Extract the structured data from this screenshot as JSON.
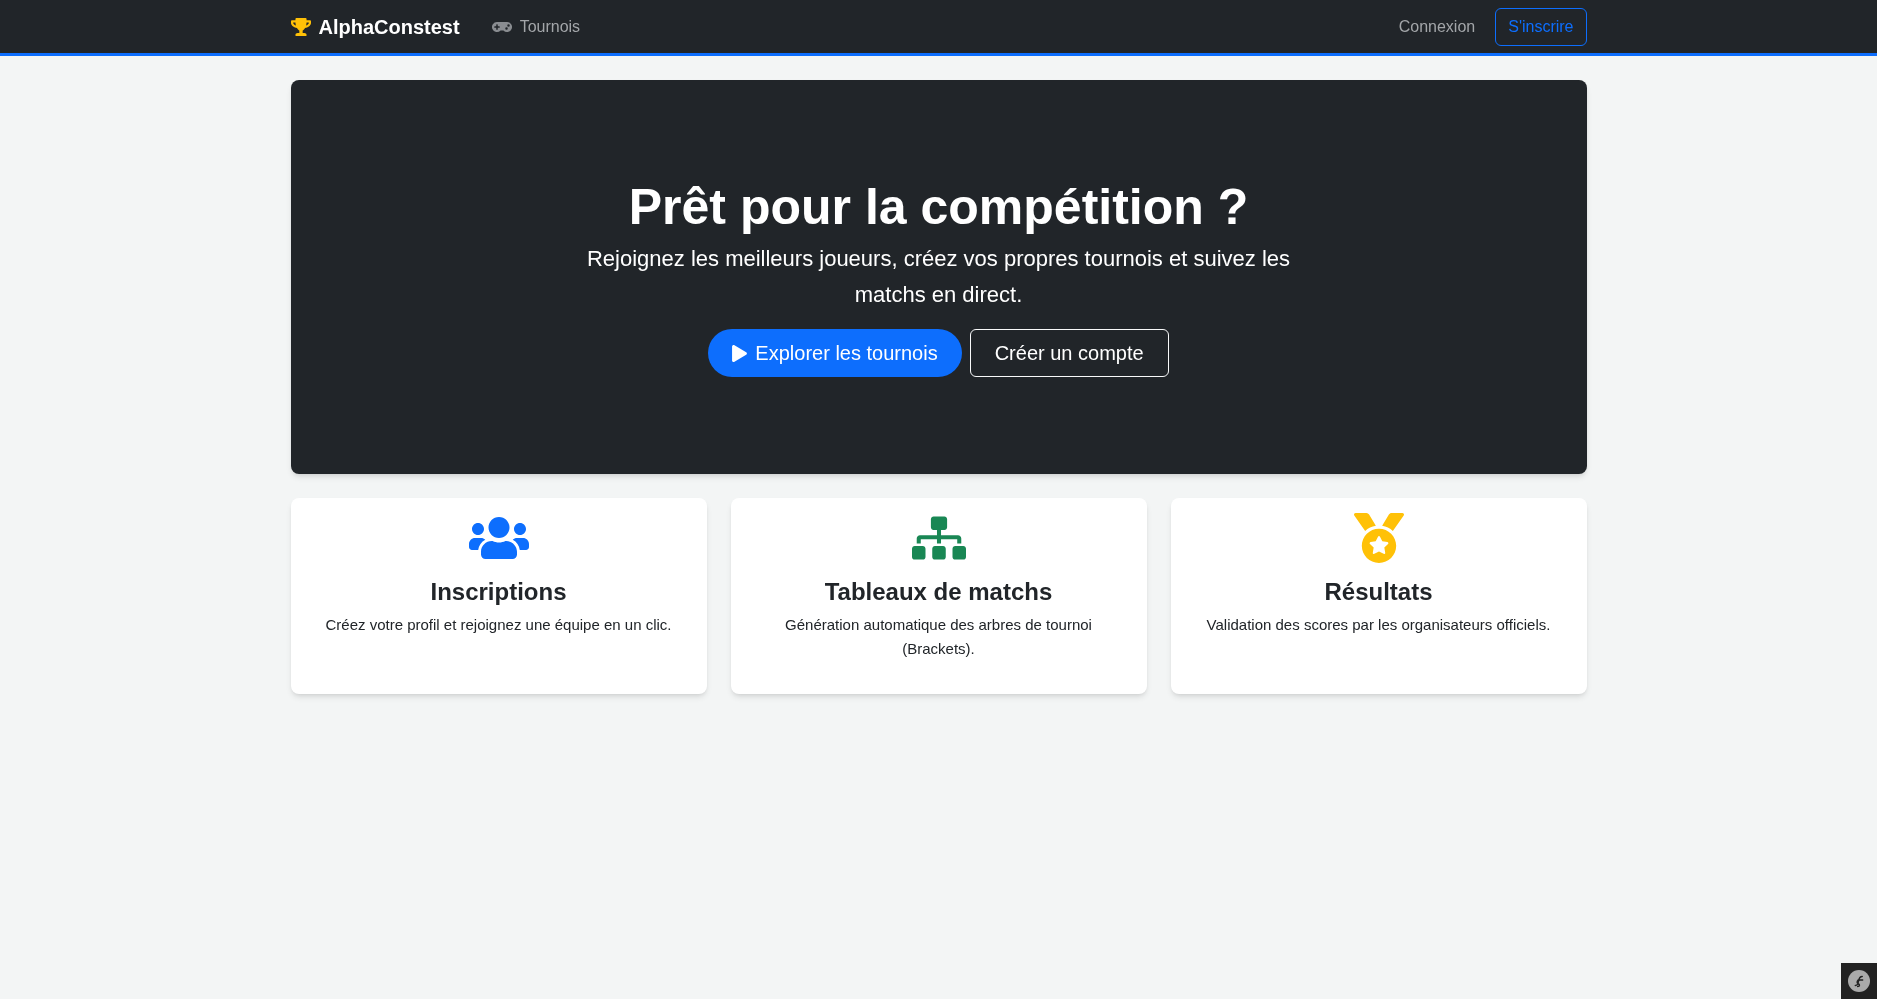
{
  "navbar": {
    "brand": "AlphaConstest",
    "links": [
      {
        "label": "Tournois",
        "kind": "gamepad"
      }
    ],
    "login": "Connexion",
    "register": "S'inscrire"
  },
  "hero": {
    "title": "Prêt pour la compétition ?",
    "subtitle": "Rejoignez les meilleurs joueurs, créez vos propres tournois et suivez les matchs en direct.",
    "buttons": [
      {
        "kind": "primary",
        "label": "Explorer les tournois"
      },
      {
        "kind": "outline",
        "label": "Créer un compte"
      }
    ]
  },
  "features": [
    {
      "kind": "people",
      "title": "Inscriptions",
      "text": "Créez votre profil et rejoignez une équipe en un clic."
    },
    {
      "kind": "bracket",
      "title": "Tableaux de matchs",
      "text": "Génération automatique des arbres de tournoi (Brackets)."
    },
    {
      "kind": "medal",
      "title": "Résultats",
      "text": "Validation des scores par les organisateurs officiels."
    }
  ]
}
